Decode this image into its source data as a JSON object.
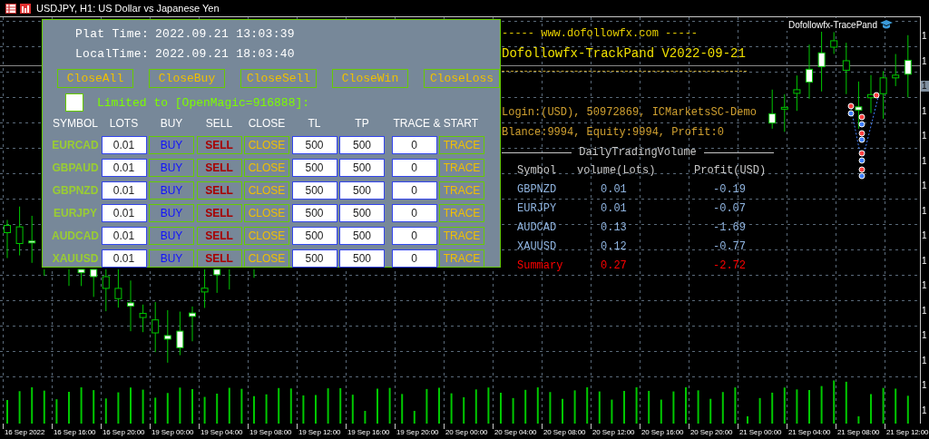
{
  "window": {
    "title": "USDJPY, H1: US Dollar vs Japanese Yen"
  },
  "indicator_label": "Dofollowfx-TracePand",
  "panel": {
    "plat_time_label": "Plat Time:",
    "plat_time": "2022.09.21 13:03:39",
    "local_time_label": "LocalTime:",
    "local_time": "2022.09.21 18:03:40",
    "close_buttons": [
      "CloseAll",
      "CloseBuy",
      "CloseSell",
      "CloseWin",
      "CloseLoss"
    ],
    "magic_filter": {
      "checked": false,
      "label": "Limited to [OpenMagic=916888]:"
    },
    "columns": [
      "SYMBOL",
      "LOTS",
      "BUY",
      "SELL",
      "CLOSE",
      "TL",
      "TP",
      "TRACE & START"
    ],
    "rows": [
      {
        "symbol": "EURCAD",
        "lots": "0.01",
        "buy": "BUY",
        "sell": "SELL",
        "close": "CLOSE",
        "tl": "500",
        "tp": "500",
        "trace": "0",
        "trace_button": "TRACE"
      },
      {
        "symbol": "GBPAUD",
        "lots": "0.01",
        "buy": "BUY",
        "sell": "SELL",
        "close": "CLOSE",
        "tl": "500",
        "tp": "500",
        "trace": "0",
        "trace_button": "TRACE"
      },
      {
        "symbol": "GBPNZD",
        "lots": "0.01",
        "buy": "BUY",
        "sell": "SELL",
        "close": "CLOSE",
        "tl": "500",
        "tp": "500",
        "trace": "0",
        "trace_button": "TRACE"
      },
      {
        "symbol": "EURJPY",
        "lots": "0.01",
        "buy": "BUY",
        "sell": "SELL",
        "close": "CLOSE",
        "tl": "500",
        "tp": "500",
        "trace": "0",
        "trace_button": "TRACE"
      },
      {
        "symbol": "AUDCAD",
        "lots": "0.01",
        "buy": "BUY",
        "sell": "SELL",
        "close": "CLOSE",
        "tl": "500",
        "tp": "500",
        "trace": "0",
        "trace_button": "TRACE"
      },
      {
        "symbol": "XAUUSD",
        "lots": "0.01",
        "buy": "BUY",
        "sell": "SELL",
        "close": "CLOSE",
        "tl": "500",
        "tp": "500",
        "trace": "0",
        "trace_button": "TRACE"
      }
    ]
  },
  "info": {
    "site_line": "-----  www.dofollowfx.com  -----",
    "title": "Dofollowfx-TrackPand V2022-09-21",
    "login": "Login:(USD), 50972869, ICMarketsSC-Demo",
    "balance": "Blance:9994,  Equity:9994,  Profit:0",
    "volume_heading": "DailyTradingVolume",
    "columns": [
      "Symbol",
      "volume(Lots)",
      "Profit(USD)"
    ],
    "rows": [
      {
        "kind": "item",
        "symbol": "GBPNZD",
        "volume": "0.01",
        "profit": "-0.19"
      },
      {
        "kind": "item",
        "symbol": "EURJPY",
        "volume": "0.01",
        "profit": "-0.07"
      },
      {
        "kind": "item",
        "symbol": "AUDCAD",
        "volume": "0.13",
        "profit": "-1.69"
      },
      {
        "kind": "item",
        "symbol": "XAUUSD",
        "volume": "0.12",
        "profit": "-0.77"
      },
      {
        "kind": "summary",
        "symbol": "Summary",
        "volume": "0.27",
        "profit": "-2.72"
      }
    ]
  },
  "price_axis": {
    "labels": [
      {
        "text": "1",
        "kind": "tick"
      },
      {
        "text": "1",
        "kind": "tick"
      },
      {
        "text": "1",
        "kind": "current"
      },
      {
        "text": "1",
        "kind": "tick"
      },
      {
        "text": "1",
        "kind": "tick"
      },
      {
        "text": "1",
        "kind": "tick"
      },
      {
        "text": "1",
        "kind": "tick"
      },
      {
        "text": "1",
        "kind": "tick"
      },
      {
        "text": "1",
        "kind": "tick"
      },
      {
        "text": "1",
        "kind": "tick"
      },
      {
        "text": "1",
        "kind": "tick"
      },
      {
        "text": "1",
        "kind": "tick"
      },
      {
        "text": "1",
        "kind": "tick"
      },
      {
        "text": "1",
        "kind": "tick"
      },
      {
        "text": "1",
        "kind": "tick"
      },
      {
        "text": "1",
        "kind": "tick"
      }
    ]
  },
  "time_axis": {
    "labels": [
      "16 Sep 2022",
      "16 Sep 16:00",
      "16 Sep 20:00",
      "19 Sep 00:00",
      "19 Sep 04:00",
      "19 Sep 08:00",
      "19 Sep 12:00",
      "19 Sep 16:00",
      "19 Sep 20:00",
      "20 Sep 00:00",
      "20 Sep 04:00",
      "20 Sep 08:00",
      "20 Sep 12:00",
      "20 Sep 16:00",
      "20 Sep 20:00",
      "21 Sep 00:00",
      "21 Sep 04:00",
      "21 Sep 08:00",
      "21 Sep 12:00"
    ]
  }
}
